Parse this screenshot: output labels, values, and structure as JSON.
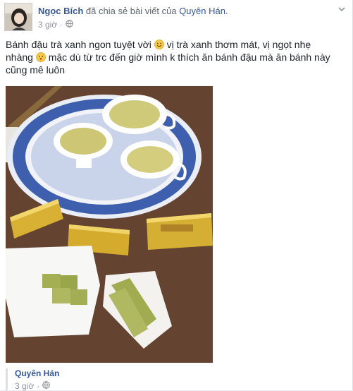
{
  "post": {
    "author": "Ngọc Bích",
    "verb": "đã chia sẻ bài viết của",
    "target": "Quyên Hán.",
    "time": "3 giờ",
    "text_part1": "Bánh đậu trà xanh ngon tuyệt vời ",
    "text_part2": " vị trà xanh thơm mát, vị ngọt nhẹ nhàng ",
    "text_part3": " mặc dù từ trc đến giờ mình k thích ăn bánh đậu mà ăn bánh này cũng mê luôn",
    "emoji_1": "smile-emoji",
    "emoji_2": "sweat-smile-emoji",
    "photo_alt": "green tea cakes and tea cups"
  },
  "shared": {
    "author": "Quyên Hán",
    "time": "3 giờ"
  },
  "icons": {
    "audience": "public-globe-icon",
    "options": "chevron-down-icon"
  },
  "colors": {
    "link": "#365899",
    "meta": "#90949c"
  }
}
